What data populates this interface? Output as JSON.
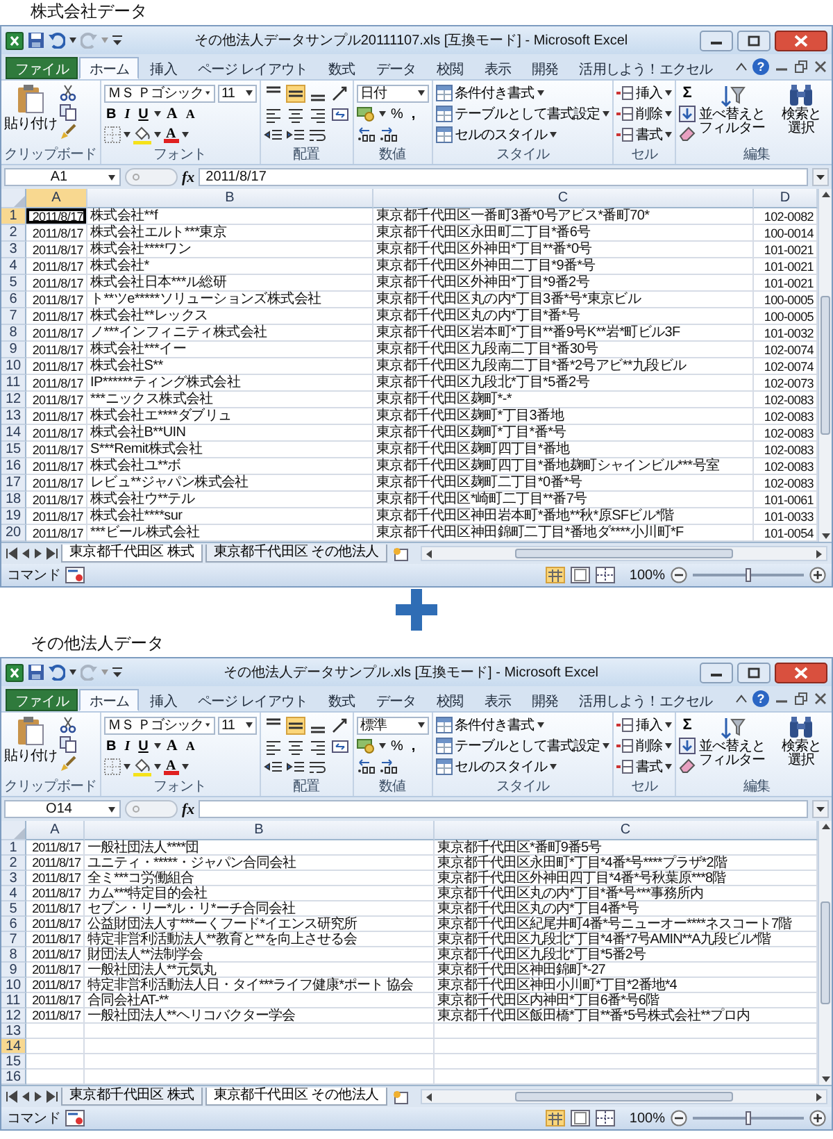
{
  "sections": [
    {
      "caption": "株式会社データ",
      "window": {
        "title": "その他法人データサンプル20111107.xls [互換モード] - Microsoft Excel",
        "tabs": [
          {
            "label": "ファイル",
            "kind": "file",
            "selected": false
          },
          {
            "label": "ホーム",
            "kind": "tab",
            "selected": true
          },
          {
            "label": "挿入",
            "kind": "tab",
            "selected": false
          },
          {
            "label": "ページ レイアウト",
            "kind": "tab",
            "selected": false
          },
          {
            "label": "数式",
            "kind": "tab",
            "selected": false
          },
          {
            "label": "データ",
            "kind": "tab",
            "selected": false
          },
          {
            "label": "校閲",
            "kind": "tab",
            "selected": false
          },
          {
            "label": "表示",
            "kind": "tab",
            "selected": false
          },
          {
            "label": "開発",
            "kind": "tab",
            "selected": false
          },
          {
            "label": "活用しよう！エクセル",
            "kind": "tab",
            "selected": false
          }
        ],
        "help": "?",
        "ribbon": {
          "paste": "貼り付け",
          "font_name": "ＭＳ Ｐゴシック",
          "font_size": "11",
          "bold": "B",
          "italic": "I",
          "underline": "U",
          "grow": "A",
          "shrink": "A",
          "font_color": "A",
          "middle_align": {
            "selected": true
          },
          "number_format": "日付",
          "percent": "%",
          "comma": ",",
          "styles": [
            "条件付き書式",
            "テーブルとして書式設定",
            "セルのスタイル"
          ],
          "cells": [
            "挿入",
            "削除",
            "書式"
          ],
          "sum": "Σ",
          "sort": [
            "並べ替えと",
            "フィルター"
          ],
          "find": [
            "検索と",
            "選択"
          ],
          "groups": [
            "クリップボード",
            "フォント",
            "配置",
            "数値",
            "スタイル",
            "セル",
            "編集"
          ]
        },
        "name_box": "A1",
        "fx": "fx",
        "formula": "2011/8/17",
        "columns": [
          {
            "label": "A",
            "selected": true
          },
          {
            "label": "B",
            "selected": false
          },
          {
            "label": "C",
            "selected": false
          },
          {
            "label": "D",
            "selected": false
          }
        ],
        "rows": [
          {
            "num": "1",
            "selected": true,
            "cells": [
              "2011/8/17",
              "株式会社**f",
              "東京都千代田区一番町3番*0号アビス*番町70*",
              "102-0082"
            ]
          },
          {
            "num": "2",
            "selected": false,
            "cells": [
              "2011/8/17",
              "株式会社エルト***東京",
              "東京都千代田区永田町二丁目*番6号",
              "100-0014"
            ]
          },
          {
            "num": "3",
            "selected": false,
            "cells": [
              "2011/8/17",
              "株式会社****ワン",
              "東京都千代田区外神田*丁目**番*0号",
              "101-0021"
            ]
          },
          {
            "num": "4",
            "selected": false,
            "cells": [
              "2011/8/17",
              "株式会社*",
              "東京都千代田区外神田二丁目*9番*号",
              "101-0021"
            ]
          },
          {
            "num": "5",
            "selected": false,
            "cells": [
              "2011/8/17",
              "株式会社日本***ル総研",
              "東京都千代田区外神田*丁目*9番2号",
              "101-0021"
            ]
          },
          {
            "num": "6",
            "selected": false,
            "cells": [
              "2011/8/17",
              "ト**ツe*****ソリューションズ株式会社",
              "東京都千代田区丸の内*丁目3番*号*東京ビル",
              "100-0005"
            ]
          },
          {
            "num": "7",
            "selected": false,
            "cells": [
              "2011/8/17",
              "株式会社**レックス",
              "東京都千代田区丸の内*丁目*番*号",
              "100-0005"
            ]
          },
          {
            "num": "8",
            "selected": false,
            "cells": [
              "2011/8/17",
              "ノ***インフィニティ株式会社",
              "東京都千代田区岩本町*丁目**番9号K**岩*町ビル3F",
              "101-0032"
            ]
          },
          {
            "num": "9",
            "selected": false,
            "cells": [
              "2011/8/17",
              "株式会社***イー",
              "東京都千代田区九段南二丁目*番30号",
              "102-0074"
            ]
          },
          {
            "num": "10",
            "selected": false,
            "cells": [
              "2011/8/17",
              "株式会社S**",
              "東京都千代田区九段南二丁目*番*2号アビ**九段ビル",
              "102-0074"
            ]
          },
          {
            "num": "11",
            "selected": false,
            "cells": [
              "2011/8/17",
              "IP******ティング株式会社",
              "東京都千代田区九段北*丁目*5番2号",
              "102-0073"
            ]
          },
          {
            "num": "12",
            "selected": false,
            "cells": [
              "2011/8/17",
              "***ニックス株式会社",
              "東京都千代田区麹町*-*",
              "102-0083"
            ]
          },
          {
            "num": "13",
            "selected": false,
            "cells": [
              "2011/8/17",
              "株式会社エ****ダブリュ",
              "東京都千代田区麹町*丁目3番地",
              "102-0083"
            ]
          },
          {
            "num": "14",
            "selected": false,
            "cells": [
              "2011/8/17",
              "株式会社B**UIN",
              "東京都千代田区麹町*丁目*番*号",
              "102-0083"
            ]
          },
          {
            "num": "15",
            "selected": false,
            "cells": [
              "2011/8/17",
              "S***Remit株式会社",
              "東京都千代田区麹町四丁目*番地",
              "102-0083"
            ]
          },
          {
            "num": "16",
            "selected": false,
            "cells": [
              "2011/8/17",
              "株式会社ユ**ボ",
              "東京都千代田区麹町四丁目*番地麹町シャインビル***号室",
              "102-0083"
            ]
          },
          {
            "num": "17",
            "selected": false,
            "cells": [
              "2011/8/17",
              "レビュ**ジャパン株式会社",
              "東京都千代田区麹町二丁目*0番*号",
              "102-0083"
            ]
          },
          {
            "num": "18",
            "selected": false,
            "cells": [
              "2011/8/17",
              "株式会社ウ**テル",
              "東京都千代田区*崎町二丁目**番7号",
              "101-0061"
            ]
          },
          {
            "num": "19",
            "selected": false,
            "cells": [
              "2011/8/17",
              "株式会社****sur",
              "東京都千代田区神田岩本町*番地**秋*原SFビル*階",
              "101-0033"
            ]
          },
          {
            "num": "20",
            "selected": false,
            "cells": [
              "2011/8/17",
              "***ビール株式会社",
              "東京都千代田区神田錦町二丁目*番地ダ****小川町*F",
              "101-0054"
            ]
          }
        ],
        "sheet_tabs": [
          {
            "label": "東京都千代田区 株式",
            "selected": true
          },
          {
            "label": "東京都千代田区 その他法人",
            "selected": false
          }
        ],
        "status": "コマンド",
        "zoom": "100%",
        "zoom_slider": {
          "level": 0.5
        }
      }
    },
    {
      "caption": "その他法人データ",
      "window": {
        "title": "その他法人データサンプル.xls [互換モード] - Microsoft Excel",
        "tabs": [
          {
            "label": "ファイル",
            "kind": "file",
            "selected": false
          },
          {
            "label": "ホーム",
            "kind": "tab",
            "selected": true
          },
          {
            "label": "挿入",
            "kind": "tab",
            "selected": false
          },
          {
            "label": "ページ レイアウト",
            "kind": "tab",
            "selected": false
          },
          {
            "label": "数式",
            "kind": "tab",
            "selected": false
          },
          {
            "label": "データ",
            "kind": "tab",
            "selected": false
          },
          {
            "label": "校閲",
            "kind": "tab",
            "selected": false
          },
          {
            "label": "表示",
            "kind": "tab",
            "selected": false
          },
          {
            "label": "開発",
            "kind": "tab",
            "selected": false
          },
          {
            "label": "活用しよう！エクセル",
            "kind": "tab",
            "selected": false
          }
        ],
        "help": "?",
        "ribbon": {
          "paste": "貼り付け",
          "font_name": "ＭＳ Ｐゴシック",
          "font_size": "11",
          "bold": "B",
          "italic": "I",
          "underline": "U",
          "grow": "A",
          "shrink": "A",
          "font_color": "A",
          "middle_align": {
            "selected": true
          },
          "number_format": "標準",
          "percent": "%",
          "comma": ",",
          "styles": [
            "条件付き書式",
            "テーブルとして書式設定",
            "セルのスタイル"
          ],
          "cells": [
            "挿入",
            "削除",
            "書式"
          ],
          "sum": "Σ",
          "sort": [
            "並べ替えと",
            "フィルター"
          ],
          "find": [
            "検索と",
            "選択"
          ],
          "groups": [
            "クリップボード",
            "フォント",
            "配置",
            "数値",
            "スタイル",
            "セル",
            "編集"
          ]
        },
        "name_box": "O14",
        "fx": "fx",
        "columns": [
          {
            "label": "A",
            "selected": false
          },
          {
            "label": "B",
            "selected": false
          },
          {
            "label": "C",
            "selected": false
          }
        ],
        "rows": [
          {
            "num": "1",
            "selected": false,
            "cells": [
              "2011/8/17",
              "一般社団法人****団",
              "東京都千代田区*番町9番5号"
            ]
          },
          {
            "num": "2",
            "selected": false,
            "cells": [
              "2011/8/17",
              "ユニティ・*****・ジャパン合同会社",
              "東京都千代田区永田町*丁目*4番*号****プラザ*2階"
            ]
          },
          {
            "num": "3",
            "selected": false,
            "cells": [
              "2011/8/17",
              "全ミ***コ労働組合",
              "東京都千代田区外神田四丁目*4番*号秋葉原***8階"
            ]
          },
          {
            "num": "4",
            "selected": false,
            "cells": [
              "2011/8/17",
              "カム***特定目的会社",
              "東京都千代田区丸の内*丁目*番*号***事務所内"
            ]
          },
          {
            "num": "5",
            "selected": false,
            "cells": [
              "2011/8/17",
              "セブン・リー*ル・リ*ーチ合同会社",
              "東京都千代田区丸の内*丁目4番*号"
            ]
          },
          {
            "num": "6",
            "selected": false,
            "cells": [
              "2011/8/17",
              "公益財団法人す***ーくフード*イエンス研究所",
              "東京都千代田区紀尾井町4番*号ニューオー****ネスコート7階"
            ]
          },
          {
            "num": "7",
            "selected": false,
            "cells": [
              "2011/8/17",
              "特定非営利活動法人**教育と**を向上させる会",
              "東京都千代田区九段北*丁目*4番*7号AMIN**A九段ビル*階"
            ]
          },
          {
            "num": "8",
            "selected": false,
            "cells": [
              "2011/8/17",
              "財団法人**法制学会",
              "東京都千代田区九段北*丁目*5番2号"
            ]
          },
          {
            "num": "9",
            "selected": false,
            "cells": [
              "2011/8/17",
              "一般社団法人**元気丸",
              "東京都千代田区神田錦町*-27"
            ]
          },
          {
            "num": "10",
            "selected": false,
            "cells": [
              "2011/8/17",
              "特定非営利活動法人日・タイ***ライフ健康*ポート 協会",
              "東京都千代田区神田小川町*丁目*2番地*4"
            ]
          },
          {
            "num": "11",
            "selected": false,
            "cells": [
              "2011/8/17",
              "合同会社AT-**",
              "東京都千代田区内神田*丁目6番*号6階"
            ]
          },
          {
            "num": "12",
            "selected": false,
            "cells": [
              "2011/8/17",
              "一般社団法人**ヘリコバクター学会",
              "東京都千代田区飯田橋*丁目**番*5号株式会社**プロ内"
            ]
          },
          {
            "num": "13",
            "selected": false
          },
          {
            "num": "14",
            "selected": true
          },
          {
            "num": "15",
            "selected": false
          },
          {
            "num": "16",
            "selected": false
          }
        ],
        "sheet_tabs": [
          {
            "label": "東京都千代田区 株式",
            "selected": false
          },
          {
            "label": "東京都千代田区 その他法人",
            "selected": true
          }
        ],
        "status": "コマンド",
        "zoom": "100%",
        "zoom_slider": {
          "level": 0.5
        }
      }
    }
  ]
}
